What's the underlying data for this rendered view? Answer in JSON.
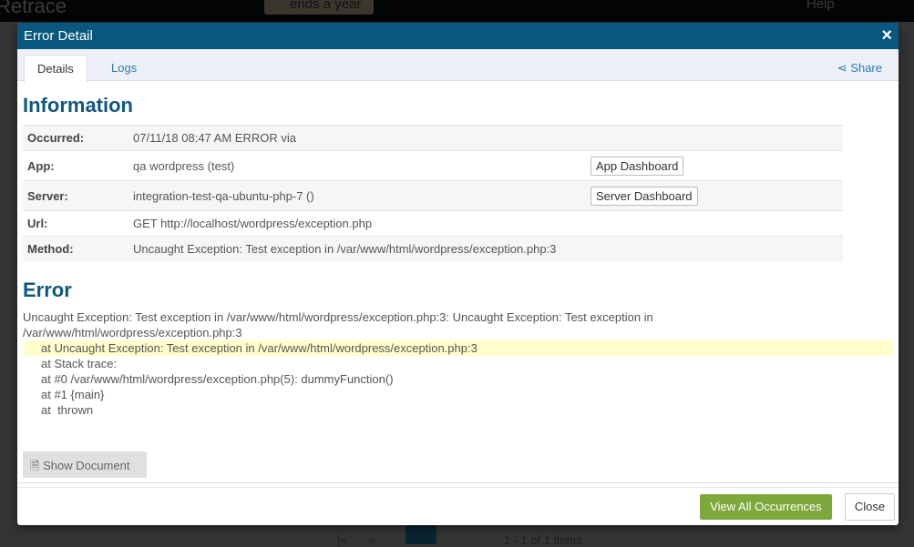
{
  "background": {
    "app_name": "Retrace",
    "time_filter": "ends a year",
    "help": "Help",
    "pager_first": "|«",
    "pager_prev": "«",
    "pager_current": "1",
    "pager_next": "»",
    "pager_last": "»|",
    "pager_info": "1 - 1 of 1 items"
  },
  "modal": {
    "title": "Error Detail",
    "close_icon": "×",
    "tabs": [
      {
        "label": "Details",
        "active": true
      },
      {
        "label": "Logs",
        "active": false
      }
    ],
    "share_label": "Share",
    "information": {
      "heading": "Information",
      "rows": [
        {
          "label": "Occurred:",
          "value": "07/11/18 08:47 AM ERROR via",
          "button": null
        },
        {
          "label": "App:",
          "value": "qa wordpress (test)",
          "button": "App Dashboard"
        },
        {
          "label": "Server:",
          "value": "integration-test-qa-ubuntu-php-7 ()",
          "button": "Server Dashboard"
        },
        {
          "label": "Url:",
          "value": "GET http://localhost/wordpress/exception.php",
          "button": null
        },
        {
          "label": "Method:",
          "value": "Uncaught Exception: Test exception in /var/www/html/wordpress/exception.php:3",
          "button": null
        }
      ]
    },
    "error": {
      "heading": "Error",
      "message": "Uncaught Exception: Test exception in /var/www/html/wordpress/exception.php:3: Uncaught Exception: Test exception in /var/www/html/wordpress/exception.php:3",
      "stack": [
        "at Uncaught Exception: Test exception in /var/www/html/wordpress/exception.php:3",
        "at Stack trace:",
        "at #0 /var/www/html/wordpress/exception.php(5): dummyFunction()",
        "at #1 {main}",
        "at  thrown"
      ]
    },
    "show_document": "Show Document",
    "footer": {
      "view_all": "View All Occurrences",
      "close": "Close"
    }
  },
  "colors": {
    "header": "#07577f",
    "accent_green": "#7ea83b",
    "highlight": "#ffffcc"
  }
}
